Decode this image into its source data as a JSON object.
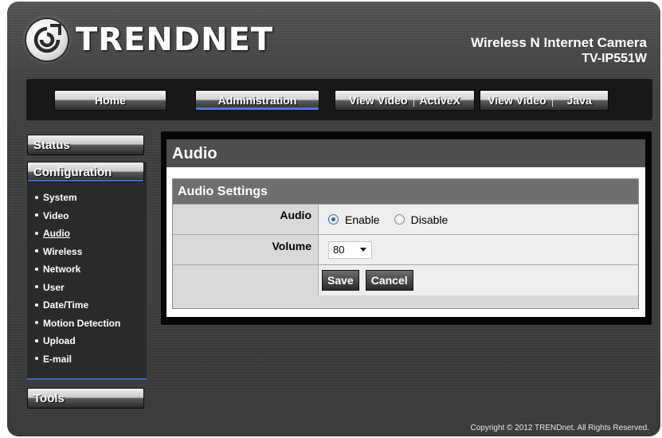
{
  "header": {
    "brand": "TRENDNET",
    "product_name": "Wireless N Internet Camera",
    "model": "TV-IP551W"
  },
  "topnav": {
    "home": "Home",
    "administration": "Administration",
    "view_video_activex": [
      "View Video",
      "ActiveX"
    ],
    "view_video_java": [
      "View Video",
      "Java"
    ],
    "active": "Administration"
  },
  "sidebar": {
    "status": "Status",
    "configuration": "Configuration",
    "items": [
      "System",
      "Video",
      "Audio",
      "Wireless",
      "Network",
      "User",
      "Date/Time",
      "Motion Detection",
      "Upload",
      "E-mail"
    ],
    "current": "Audio",
    "tools": "Tools"
  },
  "main": {
    "title": "Audio",
    "section_title": "Audio Settings",
    "audio_label": "Audio",
    "audio_options": [
      "Enable",
      "Disable"
    ],
    "audio_selected": "Enable",
    "volume_label": "Volume",
    "volume_value": "80",
    "save_label": "Save",
    "cancel_label": "Cancel"
  },
  "footer": {
    "copyright": "Copyright © 2012 TRENDnet.  All Rights Reserved."
  },
  "colors": {
    "accent_blue": "#3c6bd0",
    "panel_dark": "#060606",
    "title_bar": "#4e4e4e",
    "section_bar": "#6f6f6f"
  }
}
